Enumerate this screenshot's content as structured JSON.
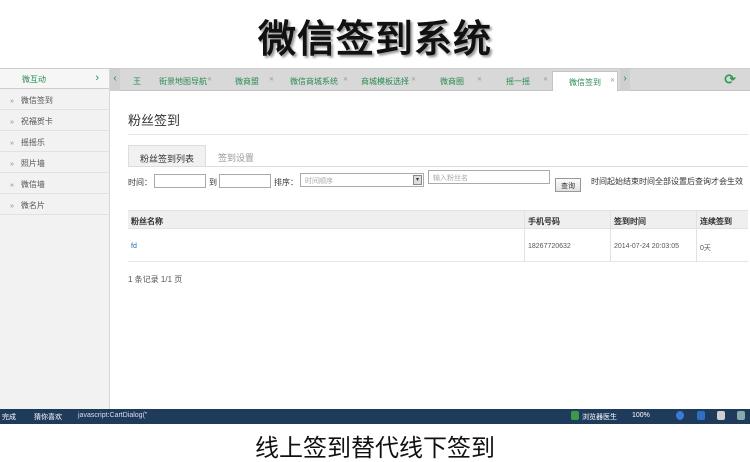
{
  "headline": "微信签到系统",
  "caption": "线上签到替代线下签到",
  "sidebar": {
    "header": "微互动",
    "items": [
      {
        "label": "微信签到"
      },
      {
        "label": "祝福贺卡"
      },
      {
        "label": "摇摇乐"
      },
      {
        "label": "照片墙"
      },
      {
        "label": "微信墙"
      },
      {
        "label": "微名片"
      }
    ]
  },
  "tabs": [
    {
      "label": "王"
    },
    {
      "label": "街景地图导航"
    },
    {
      "label": "微商盟"
    },
    {
      "label": "微信商城系统"
    },
    {
      "label": "商城模板选择"
    },
    {
      "label": "微商圈"
    },
    {
      "label": "摇一摇"
    },
    {
      "label": "微信签到",
      "active": true
    }
  ],
  "page": {
    "title": "粉丝签到",
    "subtabs": {
      "list": "粉丝签到列表",
      "settings": "签到设置"
    }
  },
  "filters": {
    "time_label": "时间：",
    "to_label": "到",
    "sort_label": "排序：",
    "sort_value": "时间顺序",
    "search_placeholder": "输入粉丝名",
    "search_button": "查询",
    "hint": "时间起始结束时间全部设置后查询才会生效"
  },
  "table": {
    "headers": [
      "粉丝名称",
      "手机号码",
      "签到时间",
      "连续签到"
    ],
    "rows": [
      [
        "fd",
        "18267720632",
        "2014-07-24 20:03:05",
        "0天"
      ]
    ],
    "pager": "1 条记录 1/1 页"
  },
  "taskbar": {
    "left1": "完成",
    "left2": "猜你喜欢",
    "status": "javascript:CartDialog(\"",
    "browser": "浏览器医生",
    "zoom": "100%"
  },
  "colors": {
    "accent": "#2a8a52",
    "taskbar": "#1f3b5c",
    "link": "#2266bb"
  }
}
